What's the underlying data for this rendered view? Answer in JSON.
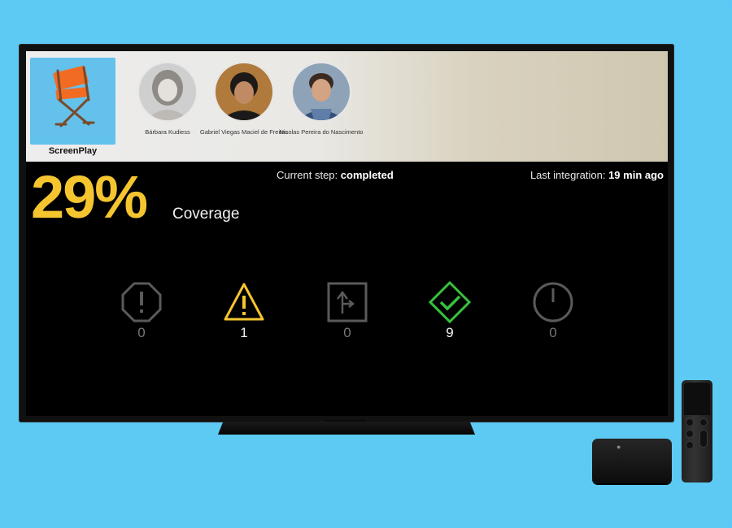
{
  "app": {
    "name": "ScreenPlay",
    "logo_icon": "director-chair-icon"
  },
  "team": [
    {
      "name": "Bárbara Kudiess",
      "avatar_icon": "avatar-photo"
    },
    {
      "name": "Gabriel Viegas Maciel de Freitas",
      "avatar_icon": "avatar-photo"
    },
    {
      "name": "Nicolas Pereira do Nascimento",
      "avatar_icon": "avatar-photo"
    }
  ],
  "status": {
    "coverage_value": "29%",
    "coverage_label": "Coverage",
    "step_label": "Current step:",
    "step_value": "completed",
    "integration_label": "Last integration:",
    "integration_value": "19 min ago"
  },
  "indicators": [
    {
      "icon": "error-octagon-icon",
      "count": "0",
      "color": "#5a5a5a"
    },
    {
      "icon": "warning-triangle-icon",
      "count": "1",
      "color": "#f5c530"
    },
    {
      "icon": "analyzer-branch-icon",
      "count": "0",
      "color": "#5a5a5a"
    },
    {
      "icon": "tests-passed-check-icon",
      "count": "9",
      "color": "#37c33c"
    },
    {
      "icon": "build-timer-icon",
      "count": "0",
      "color": "#5a5a5a"
    }
  ],
  "colors": {
    "background": "#5dcaf4",
    "coverage": "#f5c530",
    "logo_tile": "#63c1ec",
    "success": "#37c33c",
    "warning": "#f5c530"
  }
}
